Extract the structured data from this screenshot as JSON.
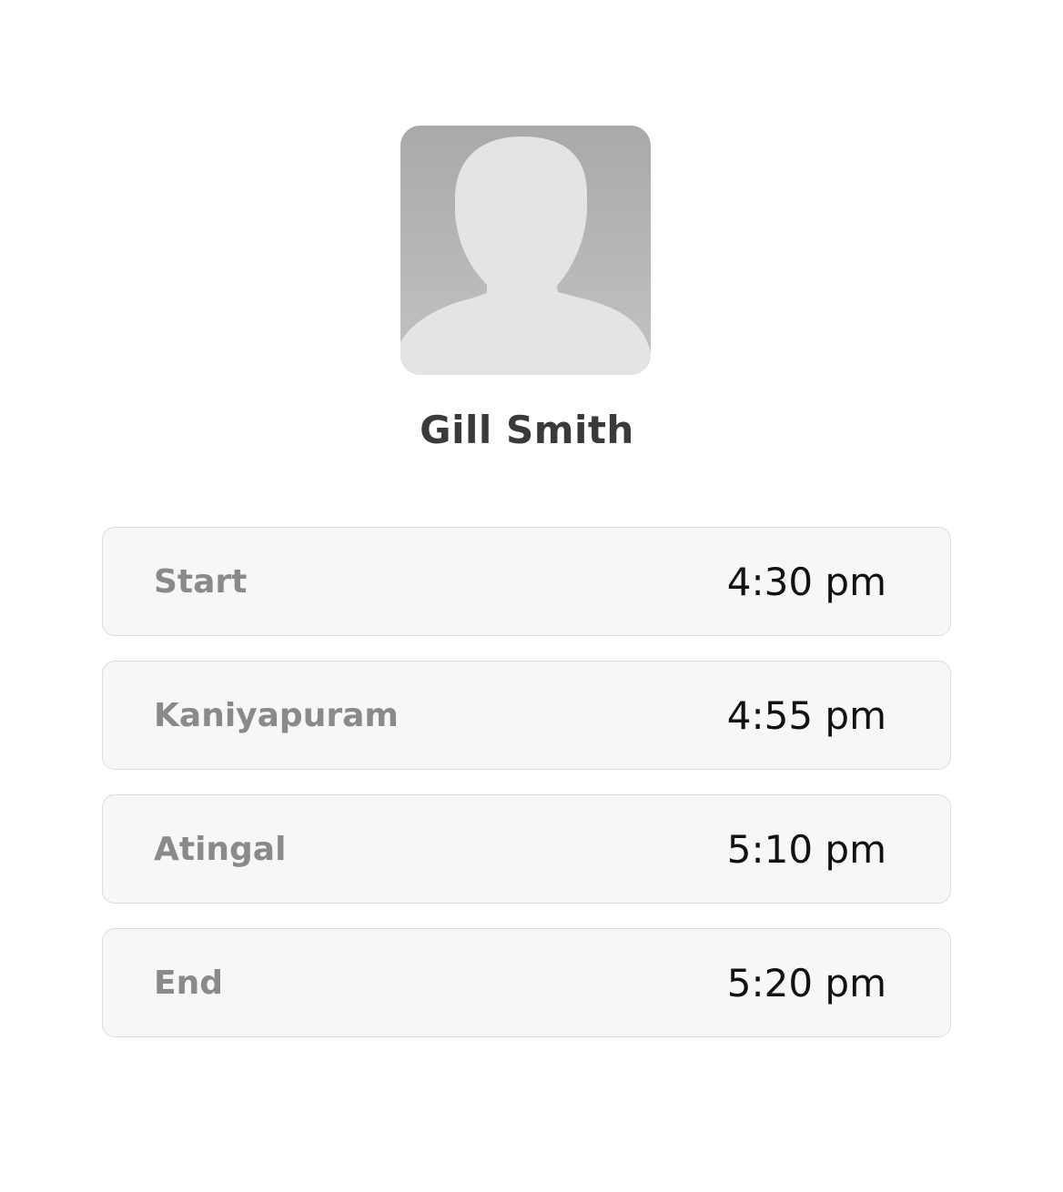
{
  "profile": {
    "name": "Gill Smith",
    "avatar_icon": "default-user-silhouette-icon"
  },
  "stops": [
    {
      "label": "Start",
      "time": "4:30 pm"
    },
    {
      "label": "Kaniyapuram",
      "time": "4:55 pm"
    },
    {
      "label": "Atingal",
      "time": "5:10 pm"
    },
    {
      "label": "End",
      "time": "5:20 pm"
    }
  ],
  "colors": {
    "avatar_bg": "#b5b5b5",
    "silhouette": "#e4e4e4",
    "row_bg": "#f7f7f7",
    "label_text": "#8a8a8a",
    "time_text": "#111111",
    "name_text": "#3a3a3a"
  }
}
